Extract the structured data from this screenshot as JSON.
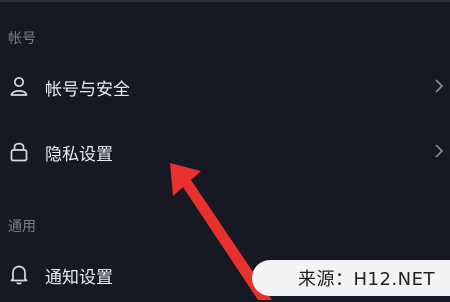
{
  "sections": [
    {
      "label": "帐号"
    },
    {
      "label": "通用"
    }
  ],
  "items": [
    {
      "label": "帐号与安全",
      "icon": "person-icon"
    },
    {
      "label": "隐私设置",
      "icon": "lock-icon"
    },
    {
      "label": "通知设置",
      "icon": "bell-icon"
    }
  ],
  "watermark": {
    "text": "来源：H12.NET"
  },
  "colors": {
    "background": "#161824",
    "arrow": "#e8312c",
    "text": "#ecedf1",
    "muted": "#7d7f8a"
  }
}
